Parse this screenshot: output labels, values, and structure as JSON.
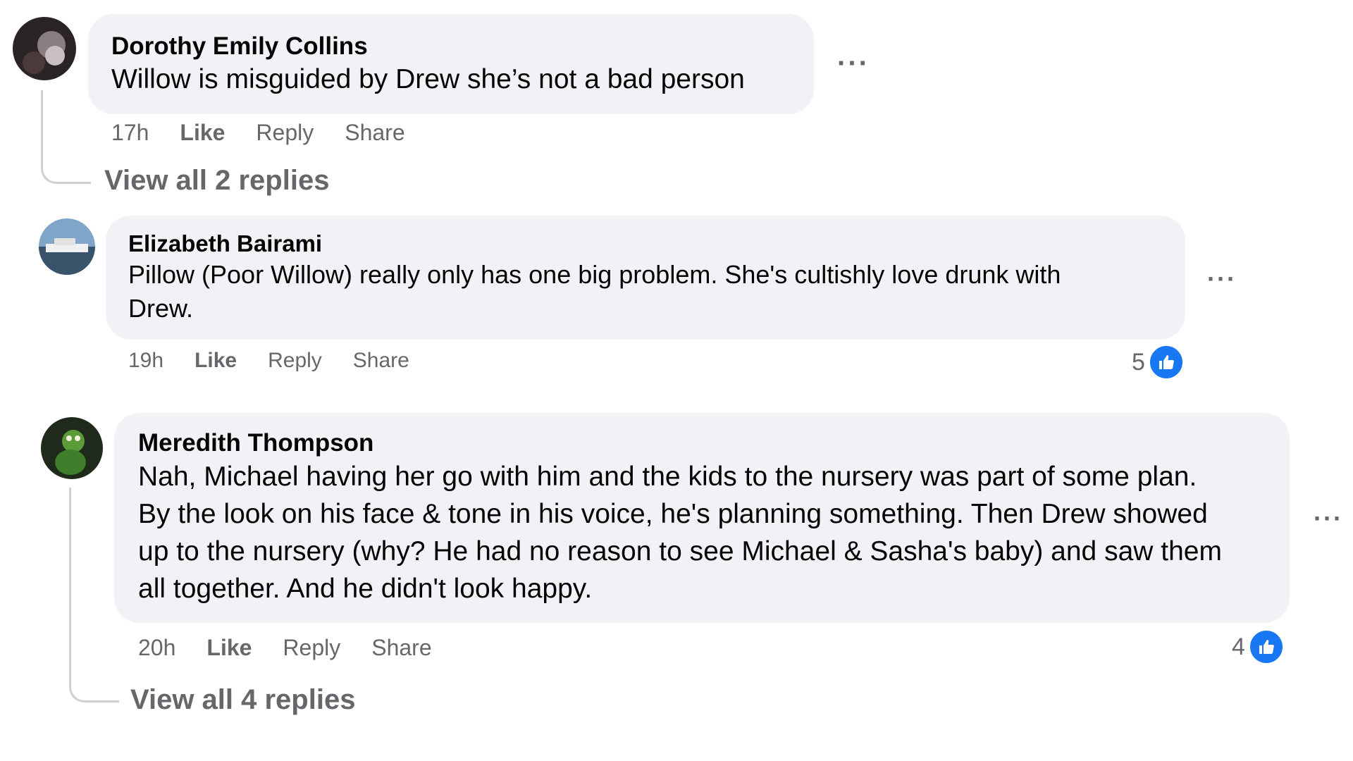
{
  "comments": [
    {
      "author": "Dorothy Emily Collins",
      "text": "Willow is misguided by Drew she’s not a bad person",
      "time": "17h",
      "like": "Like",
      "reply": "Reply",
      "share": "Share",
      "more": "···",
      "view_replies": "View all 2 replies"
    },
    {
      "author": "Elizabeth Bairami",
      "text_line1": "Pillow (Poor Willow) really only has one big problem. She's cultishly love drunk with",
      "text_line2": "Drew.",
      "time": "19h",
      "like": "Like",
      "reply": "Reply",
      "share": "Share",
      "more": "···",
      "reaction_count": "5"
    },
    {
      "author": "Meredith Thompson",
      "text_line1": "Nah, Michael having her go with him and the kids to the nursery was part of some plan.",
      "text_line2": "By the look on his face & tone in his voice, he's planning something. Then Drew showed",
      "text_line3": "up to the nursery (why? He had no reason to see Michael & Sasha's baby) and saw them",
      "text_line4": "all together. And he didn't look happy.",
      "time": "20h",
      "like": "Like",
      "reply": "Reply",
      "share": "Share",
      "more": "···",
      "reaction_count": "4",
      "view_replies": "View all 4 replies"
    }
  ],
  "colors": {
    "bubble": "#f0f2f5",
    "meta": "#65676b",
    "like_blue": "#1877f2"
  },
  "icons": {
    "like": "thumbs-up-icon"
  }
}
